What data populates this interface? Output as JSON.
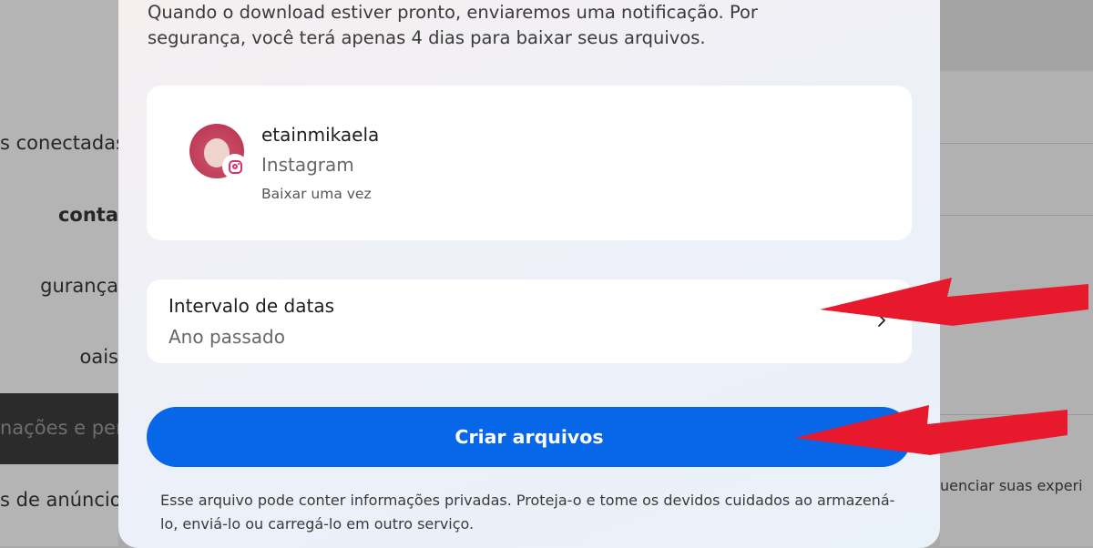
{
  "background": {
    "sidebar_items": [
      "s conectadas",
      "conta",
      "gurança",
      "oais",
      "nações e per",
      "s de anúncio"
    ],
    "right_text": "uenciar suas experi"
  },
  "modal": {
    "intro": "Quando o download estiver pronto, enviaremos uma notificação. Por segurança, você terá apenas 4 dias para baixar seus arquivos.",
    "account": {
      "username": "etainmikaela",
      "platform": "Instagram",
      "download_note": "Baixar uma vez"
    },
    "date_range": {
      "title": "Intervalo de datas",
      "value": "Ano passado"
    },
    "create_button": "Criar arquivos",
    "disclaimer": "Esse arquivo pode conter informações privadas. Proteja-o e tome os devidos cuidados ao armazená-lo, enviá-lo ou carregá-lo em outro serviço."
  },
  "colors": {
    "primary_button": "#0866e8",
    "arrow": "#e8192c"
  },
  "icons": {
    "badge": "instagram-icon",
    "chevron": "chevron-right-icon"
  }
}
